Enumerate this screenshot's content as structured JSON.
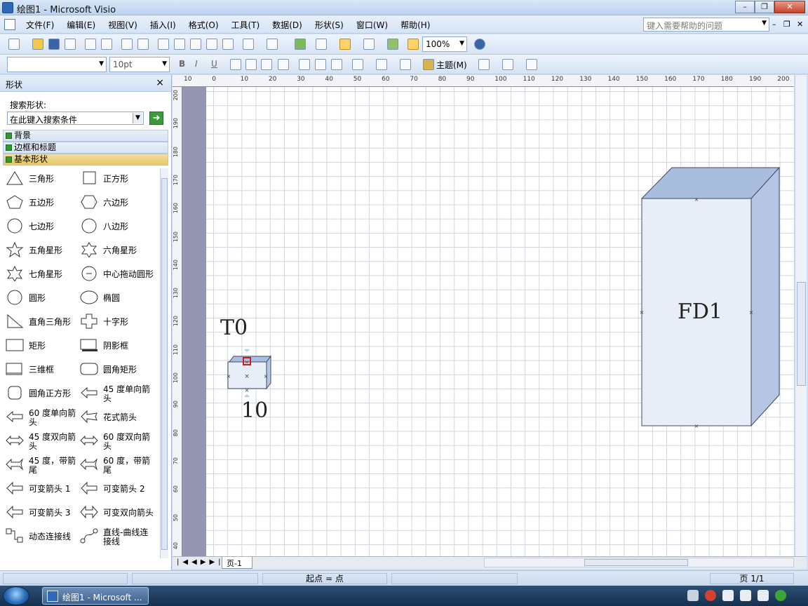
{
  "window": {
    "title": "绘图1 - Microsoft Visio"
  },
  "menu": {
    "items": [
      "文件(F)",
      "编辑(E)",
      "视图(V)",
      "插入(I)",
      "格式(O)",
      "工具(T)",
      "数据(D)",
      "形状(S)",
      "窗口(W)",
      "帮助(H)"
    ],
    "help_placeholder": "键入需要帮助的问题"
  },
  "toolbar": {
    "zoom": "100%",
    "font_size": "10pt",
    "theme_label": "主题(M)"
  },
  "shapes_panel": {
    "title": "形状",
    "search_label": "搜索形状:",
    "search_placeholder": "在此键入搜索条件",
    "stencils": [
      "背景",
      "边框和标题",
      "基本形状"
    ],
    "items": [
      "三角形",
      "正方形",
      "五边形",
      "六边形",
      "七边形",
      "八边形",
      "五角星形",
      "六角星形",
      "七角星形",
      "中心拖动圆形",
      "圆形",
      "椭圆",
      "直角三角形",
      "十字形",
      "矩形",
      "阴影框",
      "三维框",
      "圆角矩形",
      "圆角正方形",
      "45 度单向箭头",
      "60 度单向箭头",
      "花式箭头",
      "45 度双向箭头",
      "60 度双向箭头",
      "45 度，带箭尾",
      "60 度，带箭尾",
      "可变箭头 1",
      "可变箭头 2",
      "可变箭头 3",
      "可变双向箭头",
      "动态连接线",
      "直线-曲线连接线"
    ]
  },
  "ruler": {
    "top_labels": [
      "10",
      "0",
      "10",
      "20",
      "30",
      "40",
      "50",
      "60",
      "70",
      "80",
      "90",
      "100",
      "110",
      "120",
      "130",
      "140",
      "150",
      "160",
      "170",
      "180",
      "190",
      "200"
    ],
    "left_labels": [
      "200",
      "190",
      "180",
      "170",
      "160",
      "150",
      "140",
      "130",
      "120",
      "110",
      "100",
      "90",
      "80",
      "70",
      "60",
      "50",
      "40"
    ]
  },
  "canvas": {
    "small_box_top_label": "T0",
    "small_box_bottom_label": "10",
    "large_box_label": "FD1"
  },
  "page_tabs": {
    "current": "页-1"
  },
  "status": {
    "start_point": "起点 = 点",
    "page": "页 1/1"
  },
  "taskbar": {
    "item_label": "绘图1 - Microsoft ..."
  },
  "colors": {
    "box_front": "#e8eef8",
    "box_side": "#b5c5e3",
    "box_top": "#a9bddf",
    "box_stroke": "#3c4a63"
  }
}
